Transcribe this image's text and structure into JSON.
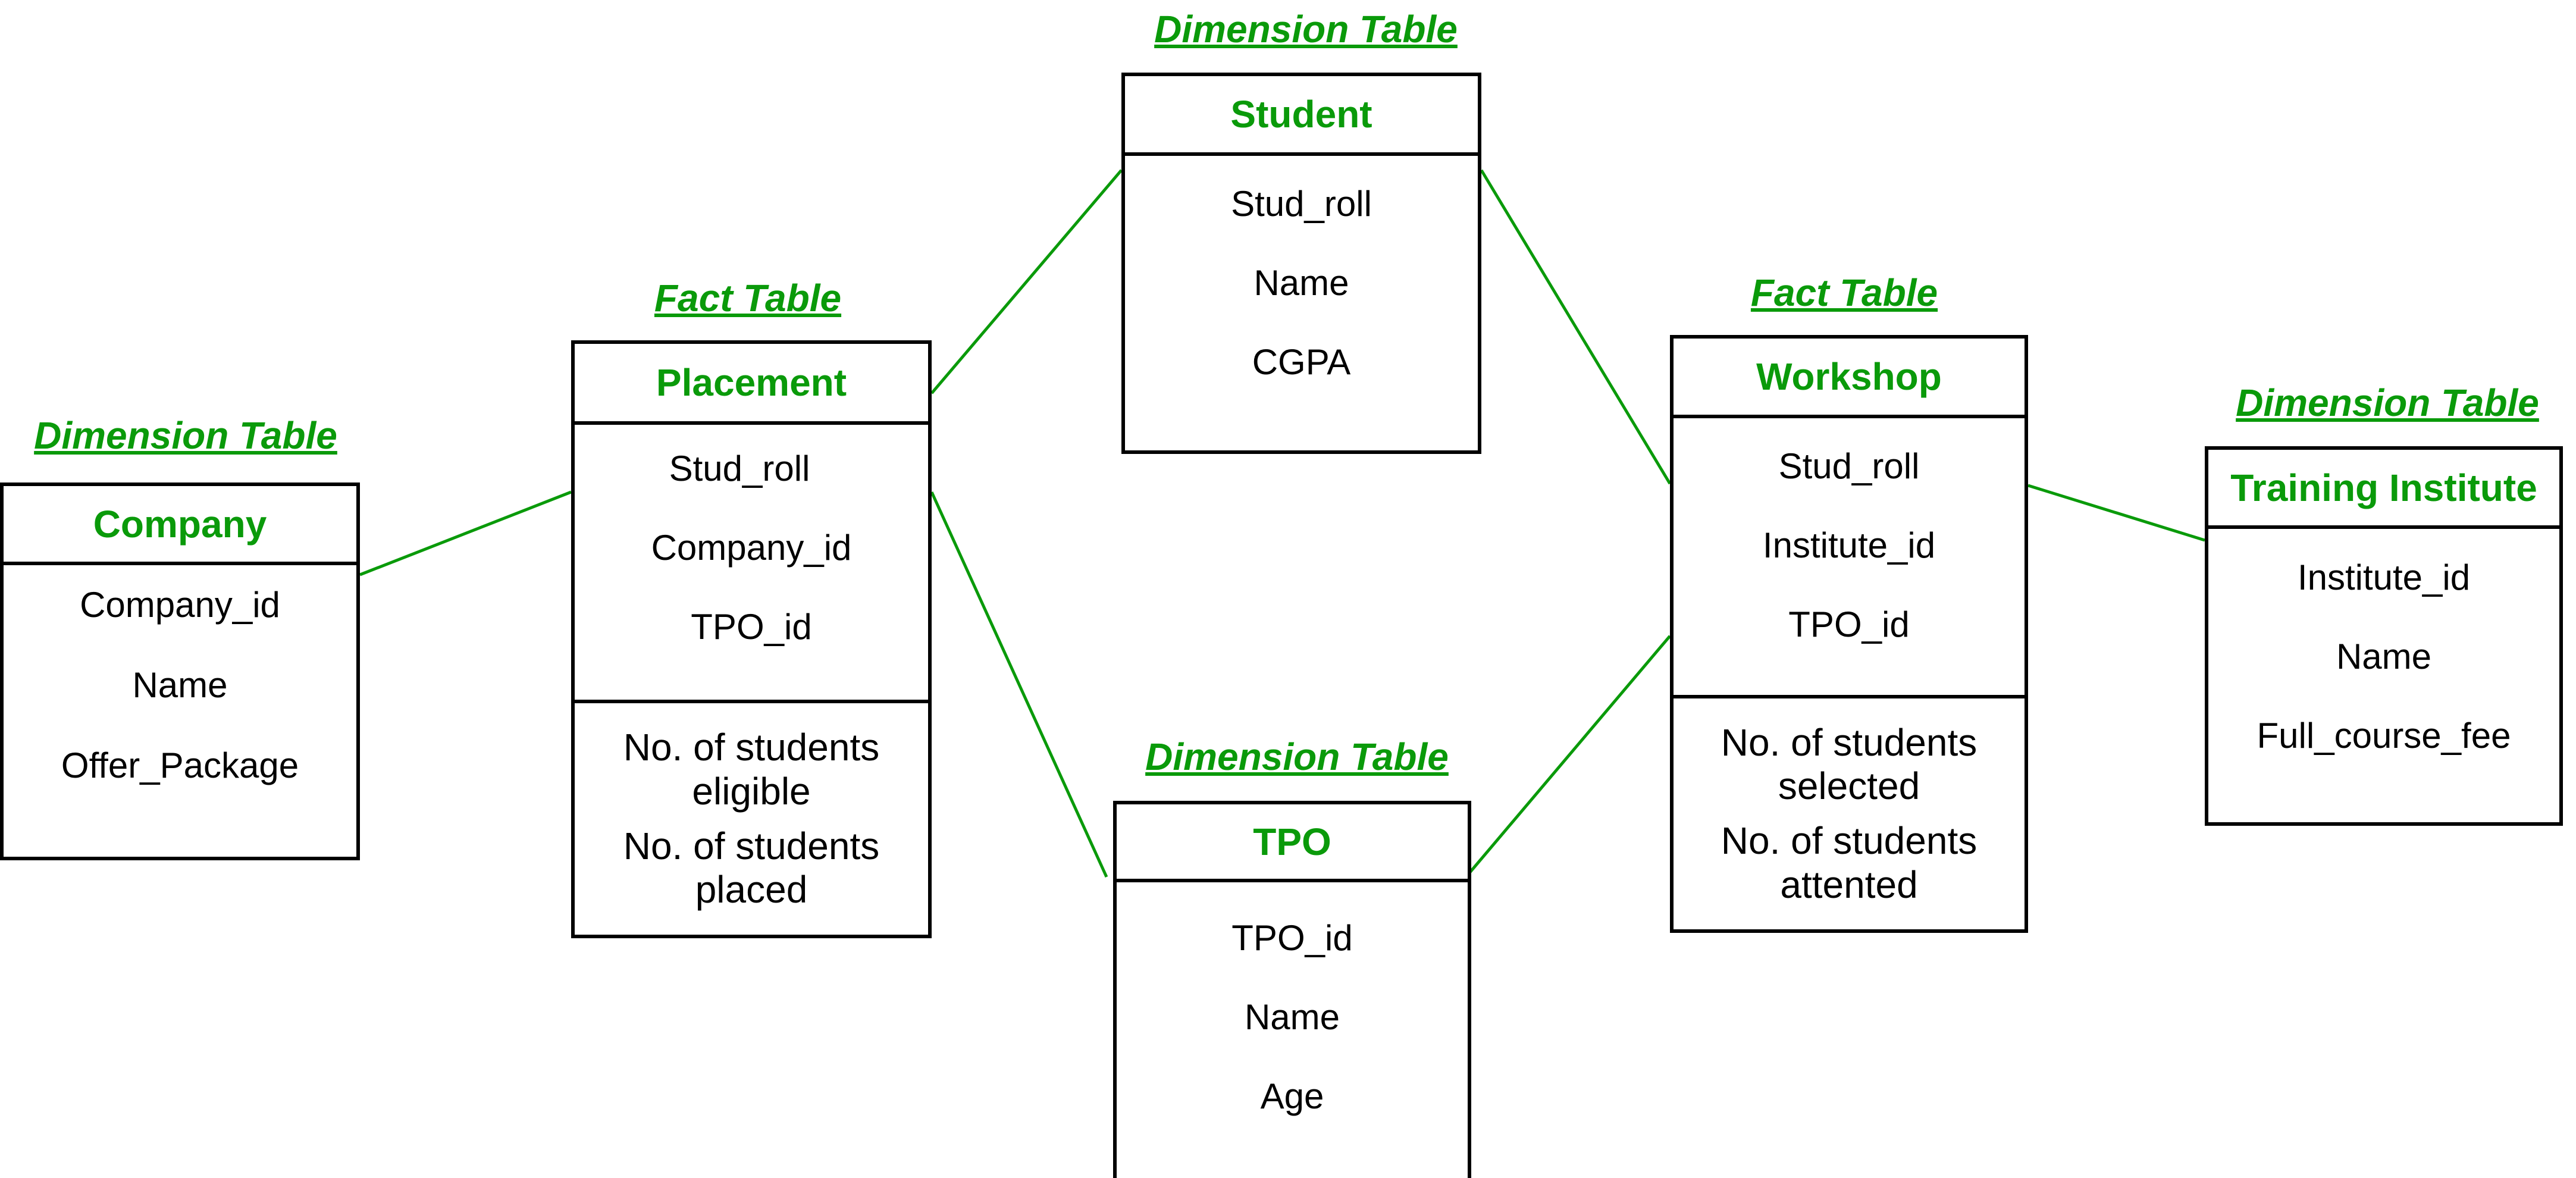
{
  "colors": {
    "accent": "#0a9a0a",
    "border": "#000000",
    "background": "#ffffff"
  },
  "tables": {
    "company": {
      "caption": "Dimension Table",
      "name": "Company",
      "keys": [
        "Company_id",
        "Name",
        "Offer_Package"
      ]
    },
    "placement": {
      "caption": "Fact Table",
      "name": "Placement",
      "keys": [
        "Stud_roll",
        "Company_id",
        "TPO_id"
      ],
      "measures": [
        "No. of students\neligible",
        "No. of students\nplaced"
      ]
    },
    "student": {
      "caption": "Dimension Table",
      "name": "Student",
      "keys": [
        "Stud_roll",
        "Name",
        "CGPA"
      ]
    },
    "tpo": {
      "caption": "Dimension Table",
      "name": "TPO",
      "keys": [
        "TPO_id",
        "Name",
        "Age"
      ]
    },
    "workshop": {
      "caption": "Fact Table",
      "name": "Workshop",
      "keys": [
        "Stud_roll",
        "Institute_id",
        "TPO_id"
      ],
      "measures": [
        "No. of students\nselected",
        "No. of students\nattented"
      ]
    },
    "training_institute": {
      "caption": "Dimension Table",
      "name": "Training Institute",
      "keys": [
        "Institute_id",
        "Name",
        "Full_course_fee"
      ]
    }
  },
  "links": [
    {
      "from": "company",
      "to": "placement"
    },
    {
      "from": "placement",
      "to": "student"
    },
    {
      "from": "placement",
      "to": "tpo"
    },
    {
      "from": "student",
      "to": "workshop"
    },
    {
      "from": "tpo",
      "to": "workshop"
    },
    {
      "from": "workshop",
      "to": "training_institute"
    }
  ]
}
